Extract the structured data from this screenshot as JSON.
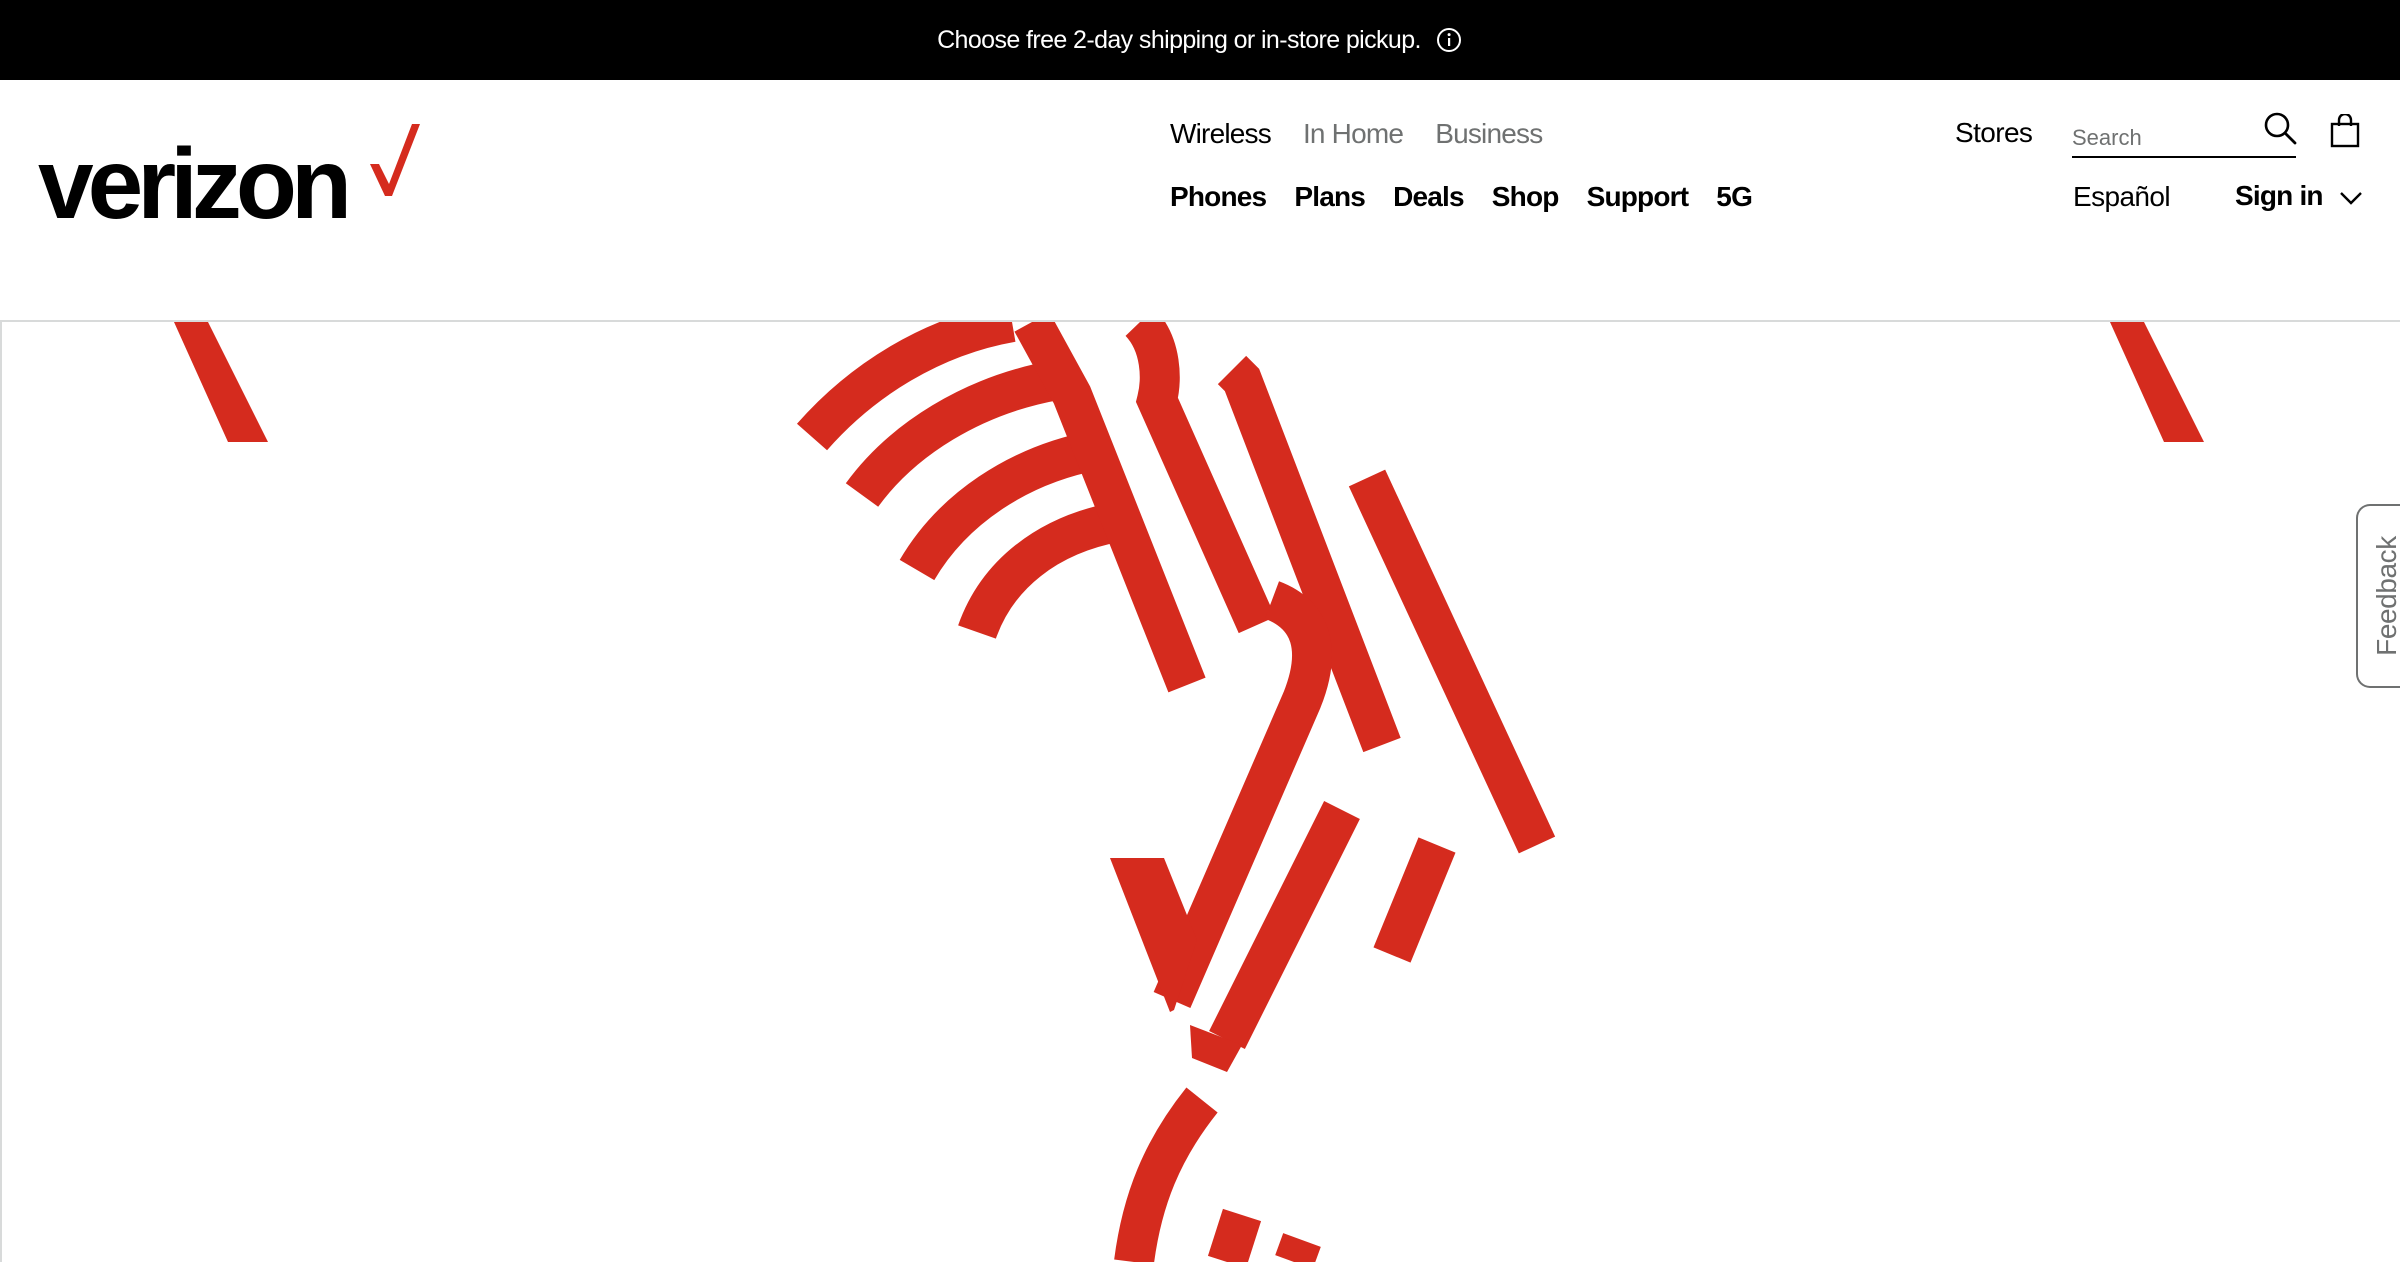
{
  "promo": {
    "text": "Choose free 2-day shipping or in-store pickup.",
    "info_icon": "info-circle-icon"
  },
  "brand": {
    "logo_text": "verizon",
    "accent_color": "#D52B1E"
  },
  "nav": {
    "top": [
      "Wireless",
      "In Home",
      "Business"
    ],
    "top_active": "Wireless",
    "main": [
      "Phones",
      "Plans",
      "Deals",
      "Shop",
      "Support",
      "5G"
    ]
  },
  "utility": {
    "stores": "Stores",
    "search_placeholder": "Search",
    "search_icon": "search-icon",
    "cart_icon": "shopping-bag-icon",
    "language": "Español",
    "signin": "Sign in",
    "signin_chevron": "chevron-down-icon"
  },
  "feedback": {
    "label": "Feedback"
  }
}
